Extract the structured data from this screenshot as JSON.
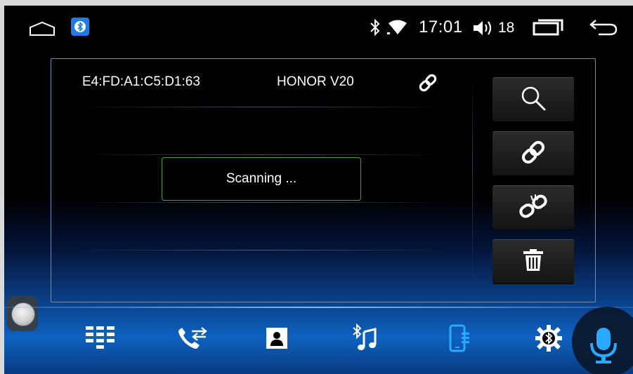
{
  "status_bar": {
    "time": "17:01",
    "volume_level": "18"
  },
  "device_list": {
    "devices": [
      {
        "address": "E4:FD:A1:C5:D1:63",
        "name": "HONOR V20",
        "status_icon": "link-icon"
      }
    ]
  },
  "scanning": {
    "text": "Scanning ..."
  },
  "actions": [
    {
      "name": "search",
      "icon": "search-icon"
    },
    {
      "name": "connect",
      "icon": "link-icon"
    },
    {
      "name": "disconnect",
      "icon": "broken-link-icon"
    },
    {
      "name": "delete",
      "icon": "trash-icon"
    }
  ],
  "dock": [
    {
      "name": "dialpad",
      "icon": "dialpad-icon"
    },
    {
      "name": "call-log",
      "icon": "call-log-icon"
    },
    {
      "name": "contacts",
      "icon": "contacts-icon"
    },
    {
      "name": "bt-music",
      "icon": "bluetooth-music-icon"
    },
    {
      "name": "devices",
      "icon": "phone-device-icon",
      "active": true
    },
    {
      "name": "settings",
      "icon": "bluetooth-settings-icon"
    }
  ],
  "colors": {
    "accent": "#29a9ff",
    "scanning_border": "#3aa34a",
    "panel_border": "#6c8fb3"
  }
}
